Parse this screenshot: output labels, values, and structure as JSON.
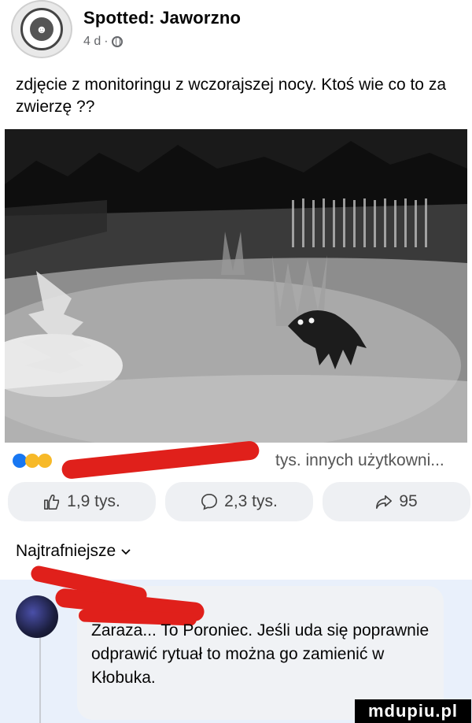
{
  "post": {
    "page_name": "Spotted: Jaworzno",
    "time_ago": "4 d",
    "separator": "·",
    "text": "zdjęcie z monitoringu z wczorajszej nocy. Ktoś wie co to za zwierzę ??"
  },
  "reactions": {
    "summary": "tys. innych użytkowni..."
  },
  "actions": {
    "like_count": "1,9 tys.",
    "comment_count": "2,3 tys.",
    "share_count": "95"
  },
  "comments": {
    "sort_label": "Najtrafniejsze",
    "first": {
      "text": "Zaraza... To Poroniec. Jeśli uda się poprawnie odprawić rytuał to można go zamienić w Kłobuka."
    }
  },
  "watermark": "mdupiu.pl",
  "colors": {
    "accent_blue": "#1877f2",
    "redaction_red": "#e0201b",
    "button_bg": "#eef0f3",
    "comment_bg": "#e9f0fb"
  }
}
